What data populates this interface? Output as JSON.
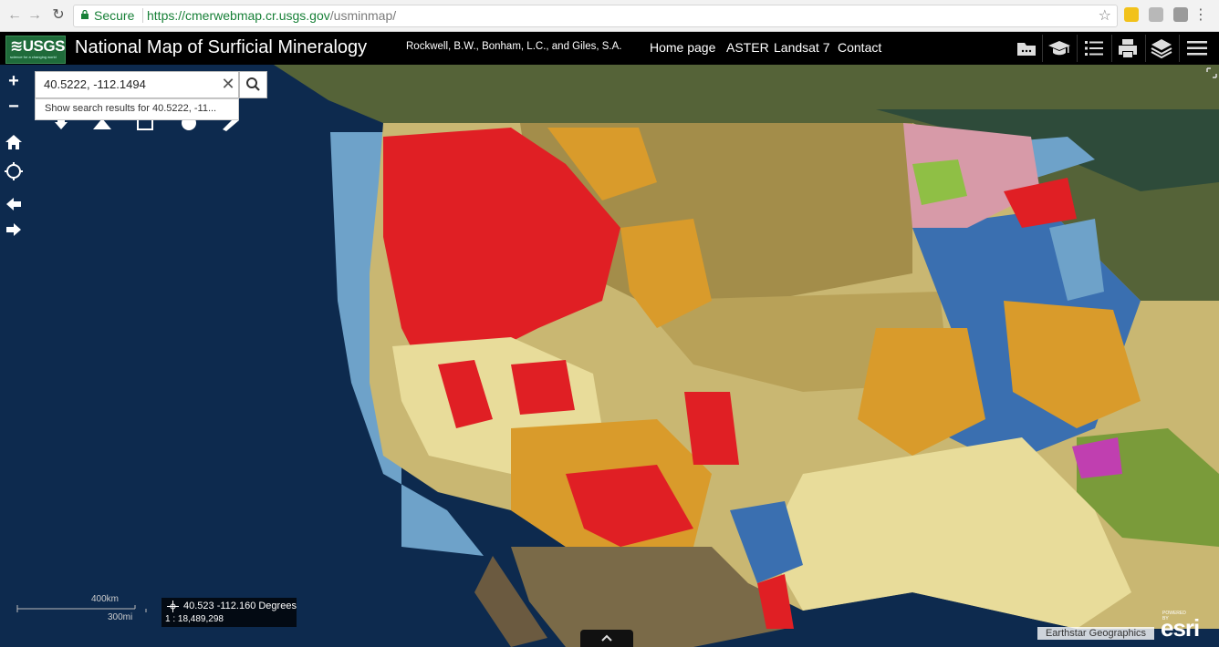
{
  "browser": {
    "secure_label": "Secure",
    "url_host": "https://cmerwebmap.cr.usgs.gov",
    "url_path": "/usminmap/",
    "icons": [
      "back-icon",
      "forward-icon",
      "reload-icon",
      "lock-icon",
      "star-icon",
      "more-vert-icon"
    ]
  },
  "header": {
    "logo_text": "≋USGS",
    "logo_tagline": "science for a changing world",
    "title": "National Map of Surficial Mineralogy",
    "authors": "Rockwell, B.W., Bonham, L.C., and Giles, S.A.",
    "nav": [
      "Home page",
      "ASTER",
      "Landsat 7",
      "Contact"
    ],
    "icons": [
      "folder-icon",
      "graduation-cap-icon",
      "list-icon",
      "print-icon",
      "layers-icon",
      "menu-icon"
    ]
  },
  "search": {
    "value": "40.5222, -112.1494",
    "suggestion": "Show search results for 40.5222, -11..."
  },
  "map": {
    "scale_metric": "400km",
    "scale_imperial": "300mi",
    "coords": "40.523 -112.160 Degrees",
    "scale_ratio": "1 : 18,489,298",
    "attribution": "Earthstar Geographics",
    "powered_by": "POWERED BY",
    "esri": "esri"
  },
  "colors": {
    "ocean": "#0d2a4e",
    "land": "#5b6b3a",
    "red_mineral": "#e01f24",
    "yellow_mineral": "#e8dc9a",
    "blue_mineral": "#3a6fb0",
    "orange_mineral": "#d99b2b",
    "tan_mineral": "#b39a4e",
    "light_blue": "#6ea2c9"
  }
}
